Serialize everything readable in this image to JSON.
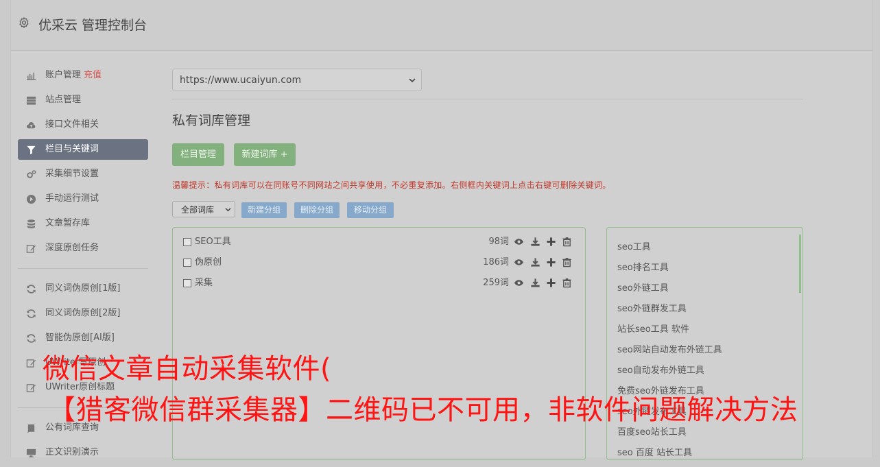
{
  "header": {
    "title": "优采云 管理控制台",
    "icon": "gear-icon"
  },
  "sidebar": {
    "group1": [
      {
        "label": "账户管理",
        "badge": "充值",
        "icon": "bar-chart-icon"
      },
      {
        "label": "站点管理",
        "icon": "server-icon"
      },
      {
        "label": "接口文件相关",
        "icon": "cloud-upload-icon"
      },
      {
        "label": "栏目与关键词",
        "icon": "filter-icon",
        "active": true
      },
      {
        "label": "采集细节设置",
        "icon": "gears-icon"
      },
      {
        "label": "手动运行测试",
        "icon": "play-icon"
      },
      {
        "label": "文章暂存库",
        "icon": "database-icon"
      },
      {
        "label": "深度原创任务",
        "icon": "edit-icon"
      }
    ],
    "group2": [
      {
        "label": "同义词伪原创[1版]",
        "icon": "refresh-icon"
      },
      {
        "label": "同义词伪原创[2版]",
        "icon": "refresh-icon"
      },
      {
        "label": "智能伪原创[AI版]",
        "icon": "refresh-icon"
      },
      {
        "label": "UWriter写原创",
        "icon": "edit-icon"
      },
      {
        "label": "UWriter原创标题",
        "icon": "edit-icon"
      }
    ],
    "group3": [
      {
        "label": "公有词库查询",
        "icon": "book-icon"
      },
      {
        "label": "正文识别演示",
        "icon": "monitor-icon"
      }
    ]
  },
  "main": {
    "site_select": "https://www.ucaiyun.com",
    "page_title": "私有词库管理",
    "btn_columns": "栏目管理",
    "btn_new_lib": "新建词库 +",
    "tip": "温馨提示：私有词库可以在同账号不同网站之间共享使用，不必重复添加。右侧框内关键词上点击右键可删除关键词。",
    "group_select": "全部词库",
    "btn_new_group": "新建分组",
    "btn_delete_group": "删除分组",
    "btn_move_group": "移动分组",
    "libraries": [
      {
        "name": "SEO工具",
        "count": "98词"
      },
      {
        "name": "伪原创",
        "count": "186词"
      },
      {
        "name": "采集",
        "count": "259词"
      }
    ],
    "keywords": [
      "seo工具",
      "seo排名工具",
      "seo外链工具",
      "seo外链群发工具",
      "站长seo工具 软件",
      "seo网站自动发布外链工具",
      "seo自动发布外链工具",
      "免费seo外链发布工具",
      "seo外链发布工具",
      "百度seo站长工具",
      "seo 百度 站长工具"
    ]
  },
  "overlay": {
    "line1": "微信文章自动采集软件(",
    "line2": "【猎客微信群采集器】二维码已不可用，非软件问题解决方法"
  },
  "colors": {
    "accent_green": "#82b17d",
    "accent_blue": "#86a9cb",
    "active_nav": "#6b7282",
    "warning_red": "#c0392b",
    "overlay_red": "#ff1414"
  }
}
